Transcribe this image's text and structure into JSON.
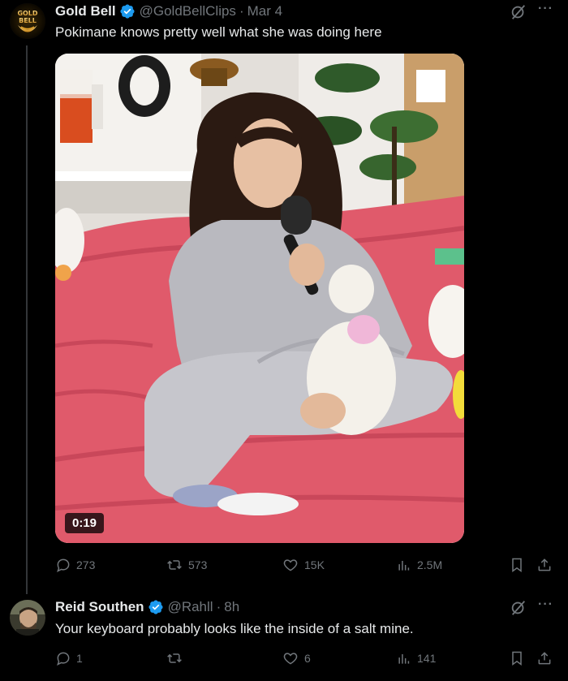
{
  "tweets": [
    {
      "display_name": "Gold Bell",
      "handle": "@GoldBellClips",
      "separator": "·",
      "time": "Mar 4",
      "text": "Pokimane knows pretty well what she was doing here",
      "avatar_text": "GOLD BELL",
      "video_duration": "0:19",
      "stats": {
        "replies": "273",
        "reposts": "573",
        "likes": "15K",
        "views": "2.5M"
      }
    },
    {
      "display_name": "Reid Southen",
      "handle": "@Rahll",
      "separator": "·",
      "time": "8h",
      "text": "Your keyboard probably looks like the inside of a salt mine.",
      "stats": {
        "replies": "1",
        "reposts": "",
        "likes": "6",
        "views": "141"
      }
    }
  ],
  "colors": {
    "background": "#000000",
    "primary_text": "#e7e9ea",
    "secondary_text": "#71767b",
    "verified_blue": "#1d9bf0",
    "thread_line": "#333639"
  },
  "icons": [
    "verified-badge-icon",
    "grok-icon",
    "more-icon",
    "reply-icon",
    "repost-icon",
    "like-icon",
    "views-icon",
    "bookmark-icon",
    "share-icon"
  ]
}
